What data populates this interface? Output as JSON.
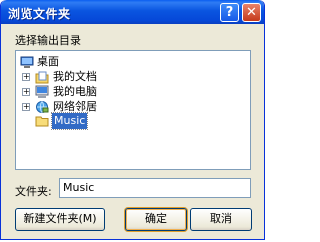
{
  "window": {
    "title": "浏览文件夹",
    "help_label": "?",
    "close_label": "✕"
  },
  "prompt": "选择输出目录",
  "tree": {
    "root": {
      "label": "桌面",
      "icon": "desktop-icon"
    },
    "items": [
      {
        "label": "我的文档",
        "icon": "my-documents-icon",
        "expander": "+"
      },
      {
        "label": "我的电脑",
        "icon": "my-computer-icon",
        "expander": "+"
      },
      {
        "label": "网络邻居",
        "icon": "network-places-icon",
        "expander": "+"
      },
      {
        "label": "Music",
        "icon": "folder-icon",
        "selected": true
      }
    ]
  },
  "folder_field": {
    "label": "文件夹:",
    "value": "Music"
  },
  "buttons": {
    "new_folder": "新建文件夹(M)",
    "ok": "确定",
    "cancel": "取消"
  },
  "colors": {
    "titlebar": "#0a55e0",
    "selection": "#316ac5",
    "dialog_bg": "#ece9d8"
  }
}
